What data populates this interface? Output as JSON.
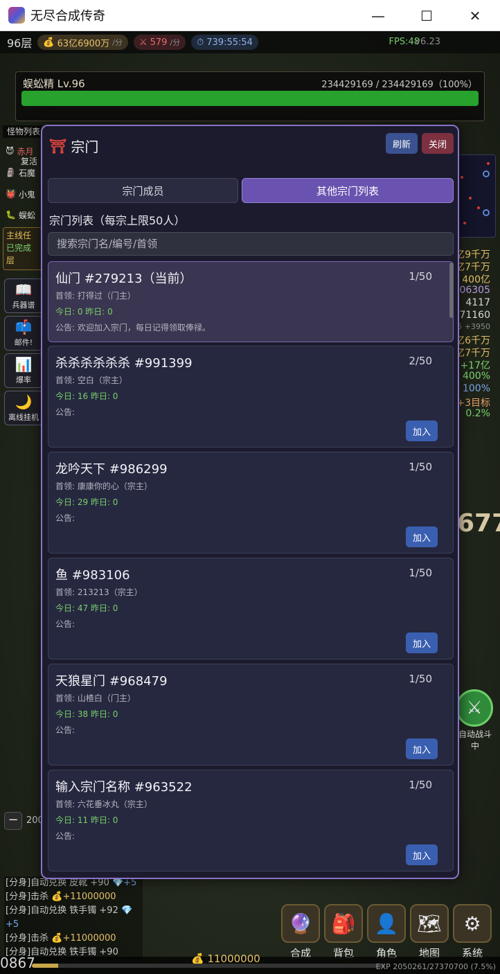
{
  "window": {
    "title": "无尽合成传奇",
    "minimize": "—",
    "maximize": "☐",
    "close": "✕"
  },
  "hud": {
    "floor": "96层",
    "gold_rate": "63亿6900万",
    "gold_unit": "/分",
    "kill_rate": "579",
    "kill_unit": "/分",
    "timer": "739:55:54",
    "fps": "FPS:48",
    "version": "v6.23"
  },
  "boss": {
    "name": "蜈蚣精 Lv.96",
    "hp_text": "234429169 / 234429169（100%）",
    "hp_fraction": 1.0
  },
  "left_panel": {
    "monster_header": "怪物列表",
    "monsters": [
      "赤月",
      "复活",
      "石魔",
      "小鬼",
      "蜈蚣"
    ],
    "quest_title": "主线任",
    "quest_done": "已完成",
    "quest_floor": "层",
    "buttons": [
      {
        "icon": "📖",
        "label": "兵器谱"
      },
      {
        "icon": "📫",
        "label": "邮件!"
      },
      {
        "icon": "📊",
        "label": "爆率"
      },
      {
        "icon": "🌙",
        "label": "离线挂机"
      }
    ]
  },
  "right_stats": [
    "亿9千万",
    "亿7千万",
    "400亿",
    "06305",
    "4117",
    "171160",
    "5 +3950",
    "亿6千万",
    "亿7千万",
    "+17亿",
    "400%",
    "100%",
    "+3目标",
    "0.2%"
  ],
  "big_damage": "677",
  "battle": {
    "label": "自动战斗中"
  },
  "speed": {
    "minus": "−",
    "value": "200"
  },
  "log": [
    {
      "text": "[分身]自动兑换 皮靴 +90 ",
      "extra": "💎+5"
    },
    {
      "text": "[分身]击杀 ",
      "extra": "💰+11000000"
    },
    {
      "text": "[分身]自动兑换 铁手镯 +92 ",
      "extra": "💎+5"
    },
    {
      "text": "[分身]击杀 ",
      "extra": "💰+11000000"
    },
    {
      "text": "[分身]自动兑换 铁手镯 +90",
      "extra": ""
    }
  ],
  "bottom_nav": [
    {
      "icon": "🔮",
      "label": "合成"
    },
    {
      "icon": "🎒",
      "label": "背包"
    },
    {
      "icon": "👤",
      "label": "角色"
    },
    {
      "icon": "🗺",
      "label": "地图"
    },
    {
      "icon": "⚙",
      "label": "系统"
    }
  ],
  "bottom": {
    "left_number": "0867",
    "gold": "💰 11000000",
    "exp_text": "EXP 2050261/27370700 (7.5%)",
    "exp_fraction": 0.075
  },
  "modal": {
    "icon": "⛩",
    "title": "宗门",
    "refresh": "刷新",
    "close": "关闭",
    "tabs": [
      "宗门成员",
      "其他宗门列表"
    ],
    "list_title": "宗门列表（每宗上限50人）",
    "search_placeholder": "搜索宗门名/编号/首领",
    "join_label": "加入",
    "sects": [
      {
        "name": "仙门 #279213（当前）",
        "count": "1/50",
        "leader": "首领: 打得过（门主）",
        "stats": "今日: 0   昨日: 0",
        "notice": "公告: 欢迎加入宗门，每日记得领取俸禄。",
        "current": true
      },
      {
        "name": "杀杀杀杀杀杀 #991399",
        "count": "2/50",
        "leader": "首领: 空白（宗主）",
        "stats": "今日: 16   昨日: 0",
        "notice": "公告:",
        "current": false
      },
      {
        "name": "龙吟天下 #986299",
        "count": "1/50",
        "leader": "首领: 康康你的心（宗主）",
        "stats": "今日: 29   昨日: 0",
        "notice": "公告:",
        "current": false
      },
      {
        "name": "鱼 #983106",
        "count": "1/50",
        "leader": "首领: 213213（宗主）",
        "stats": "今日: 47   昨日: 0",
        "notice": "公告:",
        "current": false
      },
      {
        "name": "天狼星门 #968479",
        "count": "1/50",
        "leader": "首领: 山楂白（门主）",
        "stats": "今日: 38   昨日: 0",
        "notice": "公告:",
        "current": false
      },
      {
        "name": "输入宗门名称 #963522",
        "count": "1/50",
        "leader": "首领: 六花垂冰丸（宗主）",
        "stats": "今日: 11   昨日: 0",
        "notice": "公告:",
        "current": false
      }
    ]
  }
}
